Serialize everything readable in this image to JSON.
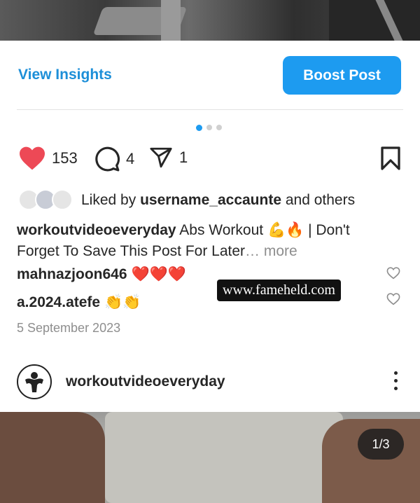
{
  "insights": {
    "view_label": "View Insights",
    "boost_label": "Boost Post"
  },
  "carousel": {
    "count": 3,
    "active_index": 0
  },
  "actions": {
    "likes": "153",
    "comments": "4",
    "shares": "1"
  },
  "liked_by": {
    "prefix": "Liked by",
    "user": "username_accaunte",
    "suffix": "and others"
  },
  "caption": {
    "user": "workoutvideoeveryday",
    "text": "Abs Workout 💪🔥 | Don't Forget To Save This Post For Later",
    "more": "… more"
  },
  "comments": [
    {
      "user": "mahnazjoon646",
      "emoji": "❤️❤️❤️"
    },
    {
      "user": "a.2024.atefe",
      "emoji": "👏👏"
    }
  ],
  "watermark": "www.fameheld.com",
  "date": "5 September 2023",
  "next_post": {
    "username": "workoutvideoeveryday",
    "counter": "1/3"
  },
  "colors": {
    "accent": "#1d9bf0",
    "like": "#ed4956"
  }
}
